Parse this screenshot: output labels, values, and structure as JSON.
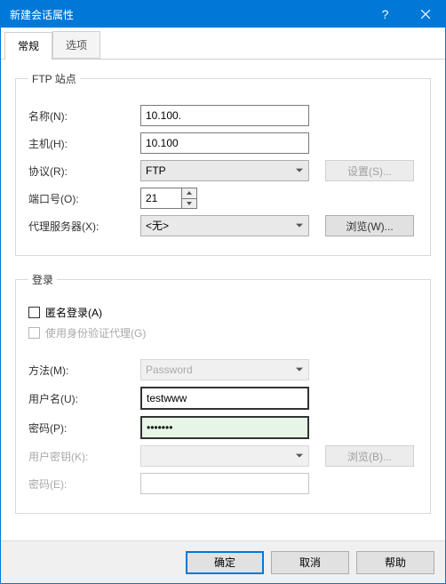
{
  "window": {
    "title": "新建会话属性"
  },
  "tabs": {
    "general": "常规",
    "options": "选项"
  },
  "ftp_group": {
    "legend": "FTP 站点",
    "name_label": "名称(N):",
    "name_value": "10.100.",
    "host_label": "主机(H):",
    "host_value": "10.100",
    "protocol_label": "协议(R):",
    "protocol_value": "FTP",
    "settings_btn": "设置(S)...",
    "port_label": "端口号(O):",
    "port_value": "21",
    "proxy_label": "代理服务器(X):",
    "proxy_value": "<无>",
    "browse_btn": "浏览(W)..."
  },
  "login_group": {
    "legend": "登录",
    "anon_label": "匿名登录(A)",
    "ident_label": "使用身份验证代理(G)",
    "method_label": "方法(M):",
    "method_value": "Password",
    "user_label": "用户名(U):",
    "user_value": "testwww",
    "pass_label": "密码(P):",
    "pass_value": "•••••••",
    "keyfile_label": "用户密钥(K):",
    "keyfile_value": "",
    "browse_btn": "浏览(B)...",
    "keypass_label": "密码(E):",
    "keypass_value": ""
  },
  "footer": {
    "ok": "确定",
    "cancel": "取消",
    "help": "帮助"
  }
}
